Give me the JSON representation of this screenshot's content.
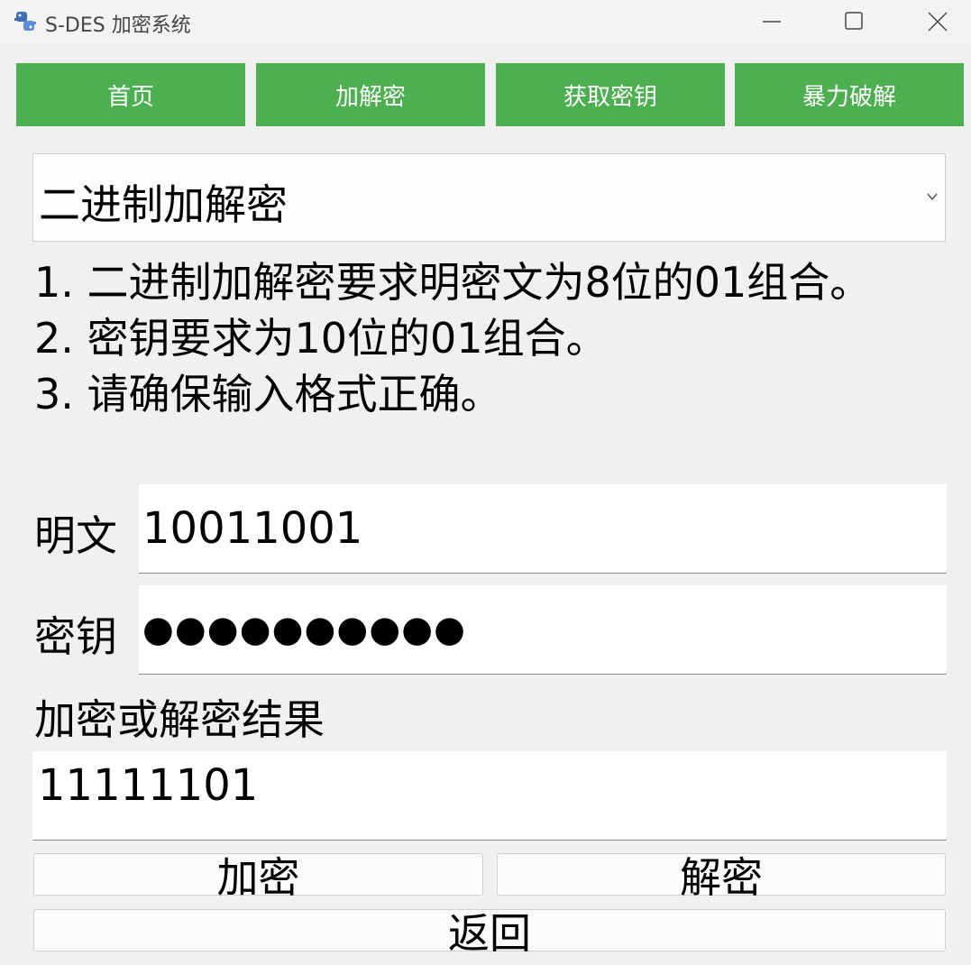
{
  "window": {
    "title": "S-DES 加密系统",
    "icon": "python-icon"
  },
  "nav": [
    {
      "label": "首页"
    },
    {
      "label": "加解密"
    },
    {
      "label": "获取密钥"
    },
    {
      "label": "暴力破解"
    }
  ],
  "mode": {
    "selected": "二进制加解密"
  },
  "instructions": [
    "1. 二进制加解密要求明密文为8位的01组合。",
    "2. 密钥要求为10位的01组合。",
    "3. 请确保输入格式正确。"
  ],
  "plaintext": {
    "label": "明文",
    "value": "10011001"
  },
  "key": {
    "label": "密钥",
    "value": "●●●●●●●●●●"
  },
  "result": {
    "label": "加密或解密结果",
    "value": "11111101"
  },
  "actions": {
    "encrypt": "加密",
    "decrypt": "解密",
    "back": "返回"
  },
  "colors": {
    "nav_bg": "#4caf50",
    "nav_text": "#ffffff",
    "window_bg": "#f0f0f0"
  }
}
